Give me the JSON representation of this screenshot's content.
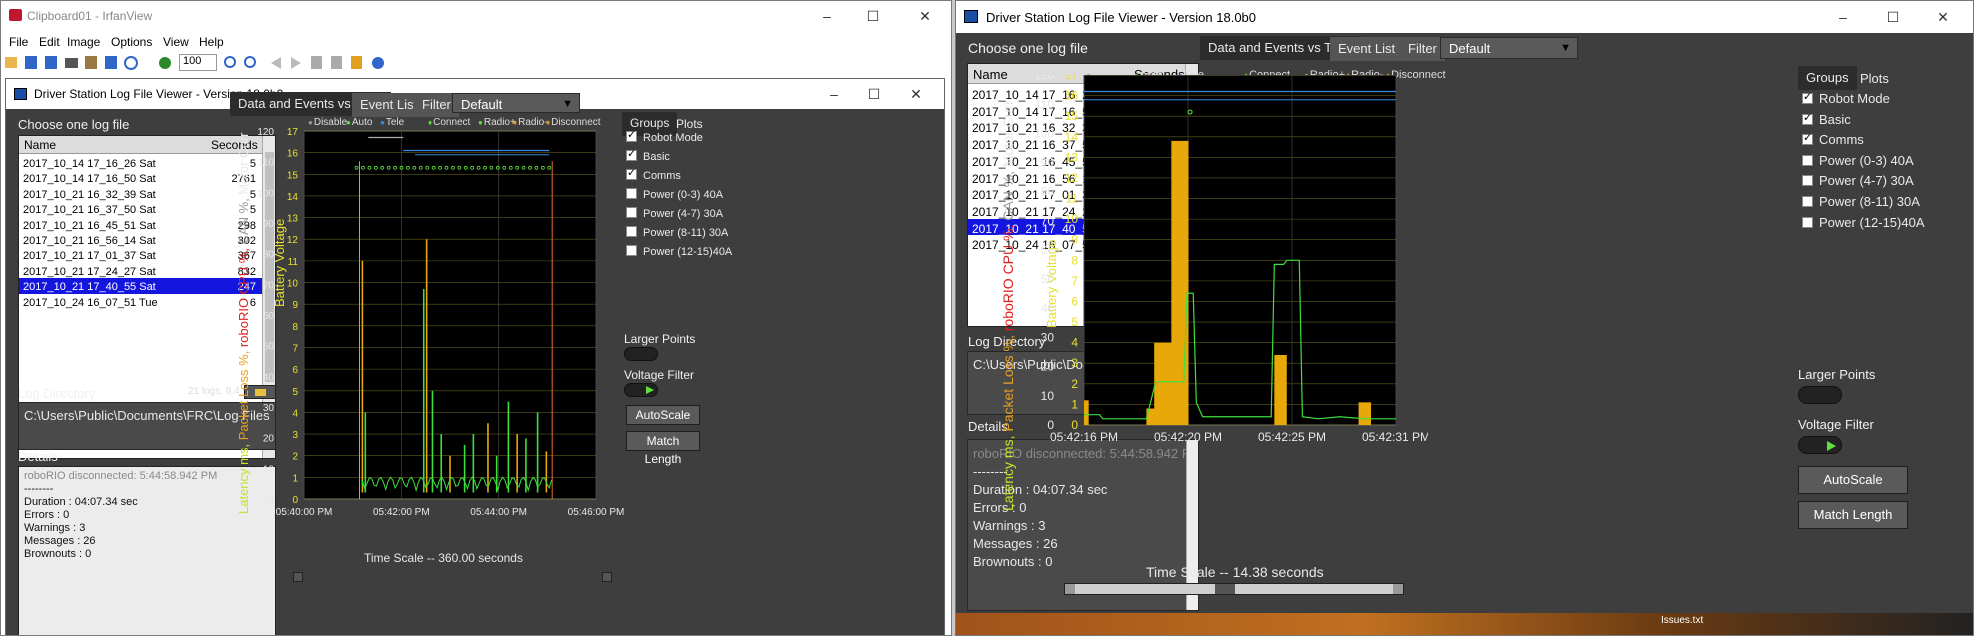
{
  "irfan": {
    "title": "Clipboard01 - IrfanView",
    "menu": [
      "File",
      "Edit",
      "Image",
      "Options",
      "View",
      "Help"
    ],
    "zoom": "100"
  },
  "left": {
    "title": "Driver Station Log File Viewer - Version 18.0b0",
    "choose_label": "Choose one log file",
    "col_name": "Name",
    "col_seconds": "Seconds",
    "files": [
      {
        "name": "2017_10_14 17_16_26 Sat",
        "seconds": "5"
      },
      {
        "name": "2017_10_14 17_16_50 Sat",
        "seconds": "2761"
      },
      {
        "name": "2017_10_21 16_32_39 Sat",
        "seconds": "5"
      },
      {
        "name": "2017_10_21 16_37_50 Sat",
        "seconds": "5"
      },
      {
        "name": "2017_10_21 16_45_51 Sat",
        "seconds": "298"
      },
      {
        "name": "2017_10_21 16_56_14 Sat",
        "seconds": "302"
      },
      {
        "name": "2017_10_21 17_01_37 Sat",
        "seconds": "367"
      },
      {
        "name": "2017_10_21 17_24_27 Sat",
        "seconds": "832"
      },
      {
        "name": "2017_10_21 17_40_55 Sat",
        "seconds": "247"
      },
      {
        "name": "2017_10_24 16_07_51 Tue",
        "seconds": "6"
      }
    ],
    "selected_index": 8,
    "log_dir_label": "Log Directory",
    "log_info": "21 logs, 9.4 MB",
    "log_dir": "C:\\Users\\Public\\Documents\\FRC\\Log Files",
    "details_label": "Details",
    "details": [
      "roboRIO disconnected:  5:44:58.942 PM",
      "--------",
      "Duration : 04:07.34 sec",
      "Errors : 0",
      "Warnings : 3",
      "Messages : 26",
      "Brownouts : 0"
    ],
    "tabs": [
      "Data and Events vs Time",
      "Event List",
      "Filter"
    ],
    "filter_value": "Default",
    "legend": [
      "Disable",
      "Auto",
      "Tele",
      "Connect",
      "Radio+",
      "Radio-",
      "Disconnect"
    ],
    "groups_tab": "Groups",
    "plots_tab": "Plots",
    "groups": [
      {
        "label": "Robot Mode",
        "checked": true
      },
      {
        "label": "Basic",
        "checked": true
      },
      {
        "label": "Comms",
        "checked": true
      },
      {
        "label": "Power (0-3) 40A",
        "checked": false
      },
      {
        "label": "Power (4-7) 30A",
        "checked": false
      },
      {
        "label": "Power (8-11) 30A",
        "checked": false
      },
      {
        "label": "Power (12-15)40A",
        "checked": false
      }
    ],
    "larger_points": "Larger Points",
    "voltage_filter": "Voltage Filter",
    "autoscale": "AutoScale",
    "match_length": "Match Length",
    "y_left_ticks": [
      "120",
      "110",
      "100",
      "90",
      "80",
      "70",
      "60",
      "50",
      "40",
      "30",
      "20",
      "10",
      "0"
    ],
    "y_right_ticks": [
      "17",
      "16",
      "15",
      "14",
      "13",
      "12",
      "11",
      "10",
      "9",
      "8",
      "7",
      "6",
      "5",
      "4",
      "3",
      "2",
      "1",
      "0"
    ],
    "x_ticks": [
      "05:40:00 PM",
      "05:42:00 PM",
      "05:44:00 PM",
      "05:46:00 PM"
    ],
    "time_scale": "Time Scale -- 360.00 seconds",
    "y_label_battery": "Battery Voltage",
    "y_label_parts": [
      {
        "text": "Latency ms, ",
        "color": "#c8e028"
      },
      {
        "text": "Packet Loss %, ",
        "color": "#e8a020"
      },
      {
        "text": "roboRIO CPU %, ",
        "color": "#e02020"
      },
      {
        "text": "CAN %, ",
        "color": "#9a9a9a"
      },
      {
        "text": "Motor Curr",
        "color": "#e8e8e8"
      }
    ]
  },
  "right": {
    "title": "Driver Station Log File Viewer - Version 18.0b0",
    "time_scale": "Time Scale -- 14.38 seconds",
    "x_ticks": [
      "05:42:16 PM",
      "05:42:20 PM",
      "05:42:25 PM",
      "05:42:31 PM"
    ]
  },
  "taskbar_text": "Issues.txt",
  "colors": {
    "battery": "#e8e030",
    "latency": "#3ee03e",
    "packet_loss": "#e8a80a",
    "cpu": "#e03030",
    "selected": "#1515e0",
    "plot_bg": "#000000",
    "grid": "#3e3e3e"
  }
}
